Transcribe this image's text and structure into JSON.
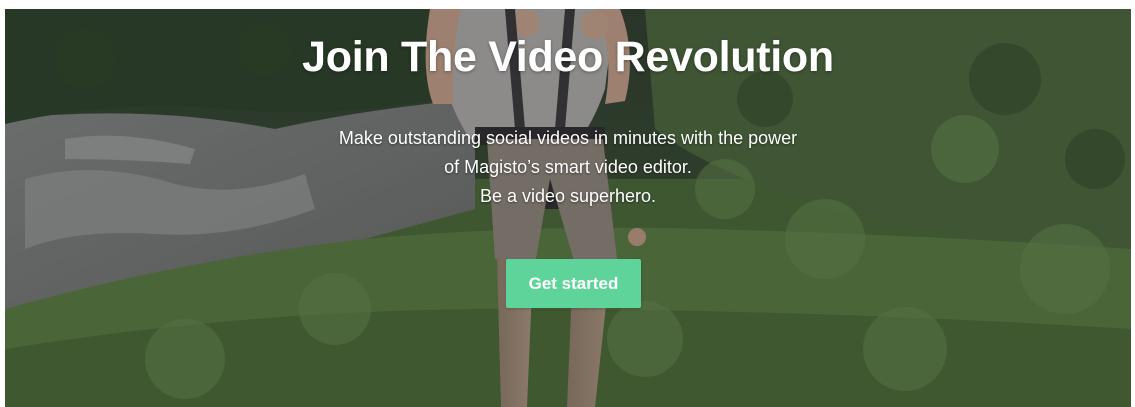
{
  "hero": {
    "title": "Join The Video Revolution",
    "lines": [
      "Make outstanding social videos in minutes with the power",
      "of Magisto’s smart video editor.",
      "Be a video superhero."
    ],
    "cta_label": "Get started",
    "background_image": "person-in-climbing-harness-over-green-ravine",
    "colors": {
      "cta": "#5ed39a",
      "text": "#ffffff"
    }
  }
}
